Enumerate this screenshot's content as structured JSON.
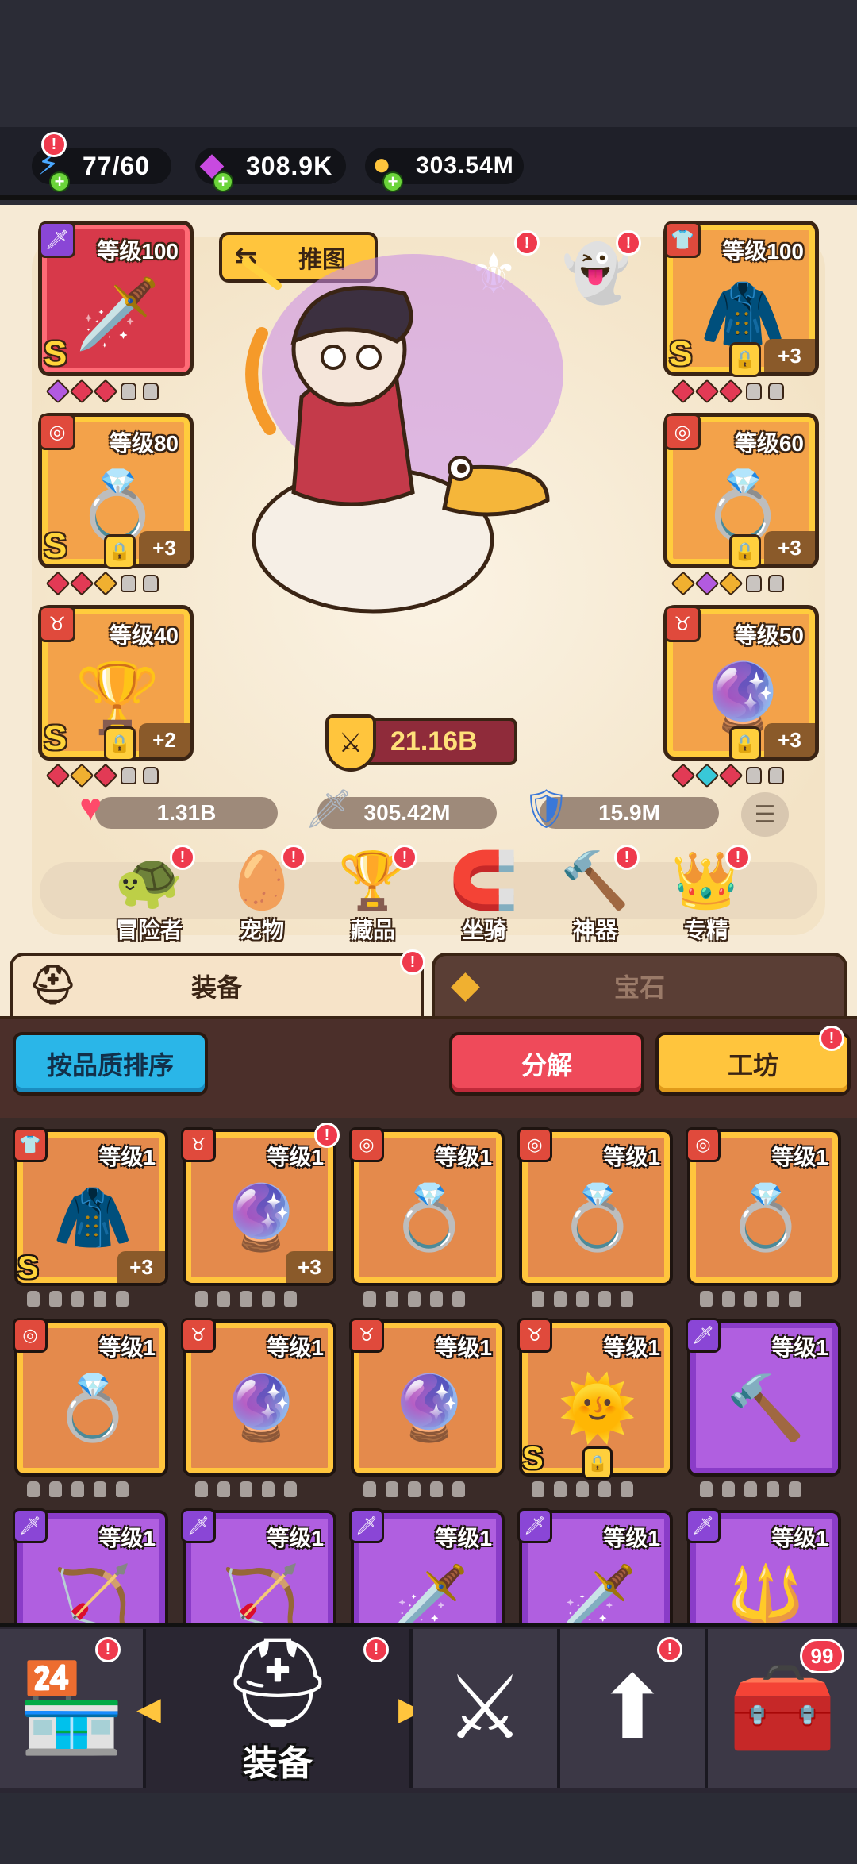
{
  "resources": {
    "energy": {
      "value": "77/60",
      "icon": "energy-icon"
    },
    "gems": {
      "value": "308.9K",
      "icon": "gem-icon"
    },
    "gold": {
      "value": "303.54M",
      "icon": "coin-icon"
    }
  },
  "stage": {
    "push_map_label": "推图",
    "power": "21.16B",
    "stats": {
      "hp": "1.31B",
      "attack": "305.42M",
      "defense": "15.9M"
    }
  },
  "equipped_left": [
    {
      "level": "等级100",
      "grade": "S",
      "plus": ""
    },
    {
      "level": "等级80",
      "grade": "S",
      "plus": "+3"
    },
    {
      "level": "等级40",
      "grade": "S",
      "plus": "+2"
    }
  ],
  "equipped_right": [
    {
      "level": "等级100",
      "grade": "S",
      "plus": "+3"
    },
    {
      "level": "等级60",
      "grade": "",
      "plus": "+3"
    },
    {
      "level": "等级50",
      "grade": "",
      "plus": "+3"
    }
  ],
  "nav": {
    "adventurer": "冒险者",
    "pet": "宠物",
    "collection": "藏品",
    "mount": "坐骑",
    "artifact": "神器",
    "mastery": "专精"
  },
  "tabs": {
    "equipment": "装备",
    "gem": "宝石"
  },
  "toolbar": {
    "sort": "按品质排序",
    "decompose": "分解",
    "workshop": "工坊"
  },
  "inventory": [
    {
      "level": "等级1",
      "grade": "S",
      "plus": "+3",
      "kind": "gold"
    },
    {
      "level": "等级1",
      "grade": "",
      "plus": "+3",
      "kind": "gold"
    },
    {
      "level": "等级1",
      "grade": "",
      "plus": "",
      "kind": "gold"
    },
    {
      "level": "等级1",
      "grade": "",
      "plus": "",
      "kind": "gold"
    },
    {
      "level": "等级1",
      "grade": "",
      "plus": "",
      "kind": "gold"
    },
    {
      "level": "等级1",
      "grade": "",
      "plus": "",
      "kind": "gold"
    },
    {
      "level": "等级1",
      "grade": "",
      "plus": "",
      "kind": "gold"
    },
    {
      "level": "等级1",
      "grade": "",
      "plus": "",
      "kind": "gold"
    },
    {
      "level": "等级1",
      "grade": "S",
      "plus": "",
      "kind": "gold"
    },
    {
      "level": "等级1",
      "grade": "",
      "plus": "",
      "kind": "purple"
    },
    {
      "level": "等级1",
      "grade": "",
      "plus": "",
      "kind": "purple"
    },
    {
      "level": "等级1",
      "grade": "",
      "plus": "",
      "kind": "purple"
    },
    {
      "level": "等级1",
      "grade": "",
      "plus": "",
      "kind": "purple"
    },
    {
      "level": "等级1",
      "grade": "",
      "plus": "",
      "kind": "purple"
    },
    {
      "level": "等级1",
      "grade": "",
      "plus": "",
      "kind": "purple"
    }
  ],
  "bottom_nav": {
    "active_label": "装备",
    "chest_count": "99"
  },
  "alert_mark": "!"
}
